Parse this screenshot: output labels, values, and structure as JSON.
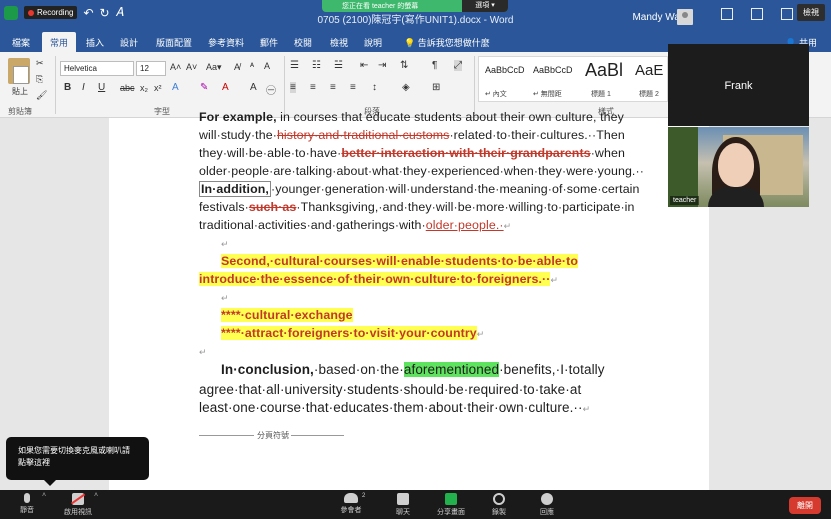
{
  "titlebar": {
    "recording_label": "Recording",
    "doc_title": "0705 (2100)陳冠宇(寫作UNIT1).docx - Word",
    "user_name": "Mandy Wang",
    "share_banner": "您正在看 teacher 的螢幕",
    "share_options": "選項 ▾",
    "view_button": "檢視"
  },
  "tabs": [
    "檔案",
    "常用",
    "插入",
    "設計",
    "版面配置",
    "參考資料",
    "郵件",
    "校閱",
    "檢視",
    "說明"
  ],
  "active_tab": "常用",
  "tell_me": "告訴我您想做什麼",
  "coauth": "共用",
  "ribbon": {
    "paste_label": "貼上",
    "clipboard_label": "剪貼簿",
    "font_label": "字型",
    "paragraph_label": "段落",
    "styles_label": "樣式",
    "font_name": "Helvetica",
    "font_size": "12",
    "styles": [
      {
        "preview": "AaBbCcD",
        "name": "↵ 內文"
      },
      {
        "preview": "AaBbCcD",
        "name": "↵ 無間距"
      },
      {
        "preview": "AaBl",
        "name": "標題 1"
      },
      {
        "preview": "AaE",
        "name": "標題 2"
      }
    ]
  },
  "document": {
    "l0_a": "For example,",
    "l0_b": " in courses that educate students about their own culture, they",
    "l1_a": "will·study·the·",
    "l1_b": "history·and·traditional·customs",
    "l1_c": "·related·to·their·cultures.··Then",
    "l2_a": "they·will·be·able·to·have·",
    "l2_b": "better·interaction·with·their·grandparents",
    "l2_c": "·when",
    "l3": "older·people·are·talking·about·what·they·experienced·when·they·were·young.··",
    "l4_a": "In·addition,",
    "l4_b": "·younger·generation·will·understand·the·meaning·of·some·certain",
    "l5_a": "festivals·",
    "l5_b": "such·as",
    "l5_c": "·Thanksgiving,·and·they·will·be·more·willing·to·participate·in",
    "l6_a": "traditional·activities·and·gatherings·with·",
    "l6_b": "older·people.·",
    "l8": "Second,·cultural·courses·will·enable·students·to·be·able·to",
    "l9": "introduce·the·essence·of·their·own·culture·to·foreigners.··",
    "l11": "****·cultural·exchange",
    "l12": "****·attract·foreigners·to·visit·your·country",
    "l14_a": "In·conclusion,",
    "l14_b": "·based·on·the·",
    "l14_c": "aforementioned",
    "l14_d": "·benefits,·I·totally",
    "l15": "agree·that·all·university·students·should·be·required·to·take·at",
    "l16": "least·one·course·that·educates·them·about·their·own·culture.··",
    "page_break": "分頁符號"
  },
  "participants": {
    "frank": "Frank",
    "teacher": "teacher"
  },
  "tooltip": "如果您需要切換麥克風或喇叭請點擊這裡",
  "zoom_toolbar": {
    "mute": "靜音",
    "video": "啟用視訊",
    "participants": "參會者",
    "participants_count": "2",
    "chat": "聊天",
    "share": "分享畫面",
    "record": "錄製",
    "reactions": "回應",
    "leave": "離開"
  }
}
